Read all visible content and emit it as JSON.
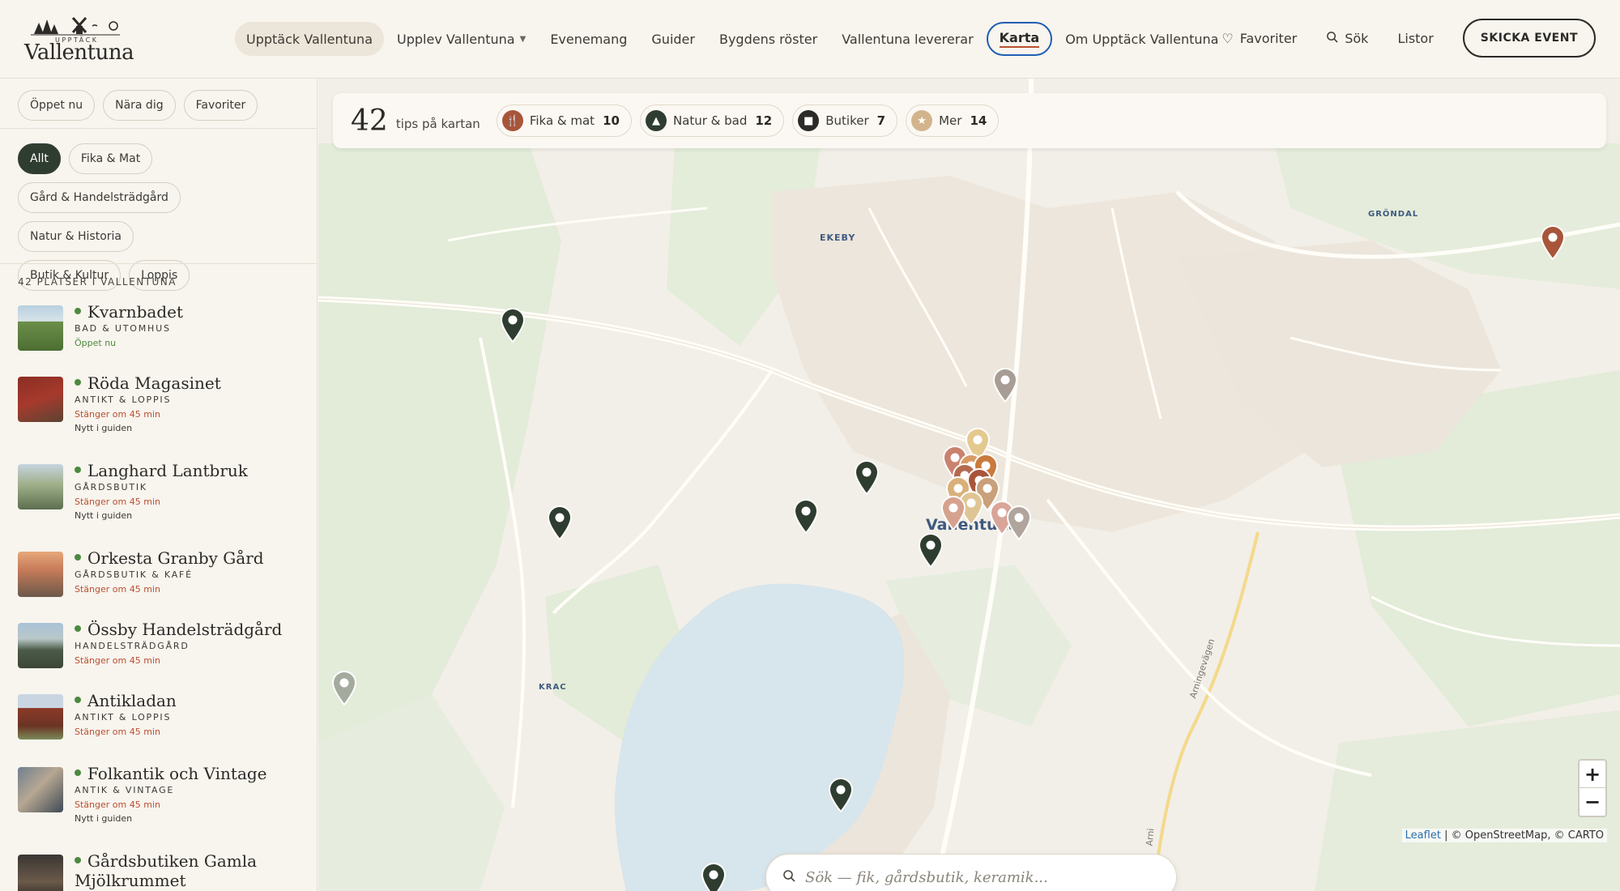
{
  "logo": {
    "top_text": "UPPTÄCK",
    "main_text": "Vallentuna"
  },
  "nav": [
    {
      "label": "Upptäck Vallentuna"
    },
    {
      "label": "Upplev Vallentuna"
    },
    {
      "label": "Evenemang"
    },
    {
      "label": "Guider"
    },
    {
      "label": "Bygdens röster"
    },
    {
      "label": "Vallentuna levererar"
    },
    {
      "label": "Karta"
    },
    {
      "label": "Om Upptäck Vallentuna"
    }
  ],
  "header_right": {
    "favorites": "Favoriter",
    "search": "Sök",
    "lists": "Listor",
    "submit_event": "SKICKA EVENT"
  },
  "quick_filters": [
    "Öppet nu",
    "Nära dig",
    "Favoriter"
  ],
  "category_filters": [
    "Allt",
    "Fika & Mat",
    "Gård & Handelsträdgård",
    "Natur & Historia",
    "Butik & Kultur",
    "Loppis"
  ],
  "list_count": "42 PLATSER I VALLENTUNA",
  "places": [
    {
      "name": "Kvarnbadet",
      "category": "BAD & UTOMHUS",
      "status": "Öppet nu",
      "status_type": "open",
      "new": ""
    },
    {
      "name": "Röda Magasinet",
      "category": "ANTIKT & LOPPIS",
      "status": "Stänger om 45 min",
      "status_type": "closing",
      "new": "Nytt i guiden"
    },
    {
      "name": "Langhard Lantbruk",
      "category": "GÅRDSBUTIK",
      "status": "Stänger om 45 min",
      "status_type": "closing",
      "new": "Nytt i guiden"
    },
    {
      "name": "Orkesta Granby Gård",
      "category": "GÅRDSBUTIK & KAFÉ",
      "status": "Stänger om 45 min",
      "status_type": "closing",
      "new": ""
    },
    {
      "name": "Össby Handelsträdgård",
      "category": "HANDELSTRÄDGÅRD",
      "status": "Stänger om 45 min",
      "status_type": "closing",
      "new": ""
    },
    {
      "name": "Antikladan",
      "category": "ANTIKT & LOPPIS",
      "status": "Stänger om 45 min",
      "status_type": "closing",
      "new": ""
    },
    {
      "name": "Folkantik och Vintage",
      "category": "ANTIK & VINTAGE",
      "status": "Stänger om 45 min",
      "status_type": "closing",
      "new": "Nytt i guiden"
    },
    {
      "name": "Gårdsbutiken Gamla Mjölkrummet",
      "category": "",
      "status": "",
      "status_type": "",
      "new": ""
    }
  ],
  "map_header": {
    "count": "42",
    "label": "tips på kartan",
    "legend": [
      {
        "name": "Fika & mat",
        "count": "10",
        "color": "#a8553a",
        "icon": "fork-knife-icon"
      },
      {
        "name": "Natur & bad",
        "count": "12",
        "color": "#2f3d30",
        "icon": "tree-icon"
      },
      {
        "name": "Butiker",
        "count": "7",
        "color": "#2b2a26",
        "icon": "bag-icon"
      },
      {
        "name": "Mer",
        "count": "14",
        "color": "#d2b48c",
        "icon": "star-icon"
      }
    ]
  },
  "map_labels": {
    "ekeby": "EKEBY",
    "grondal": "GRÖNDAL",
    "krac": "KRAC",
    "town": "Vallentuna",
    "road1": "Arningevägen",
    "road2": "Arni"
  },
  "map_controls": {
    "zoom_in": "+",
    "zoom_out": "−"
  },
  "attribution": {
    "leaflet": "Leaflet",
    "rest": "| © OpenStreetMap, © CARTO"
  },
  "map_search": {
    "placeholder": "Sök — fik, gårdsbutik, keramik..."
  }
}
